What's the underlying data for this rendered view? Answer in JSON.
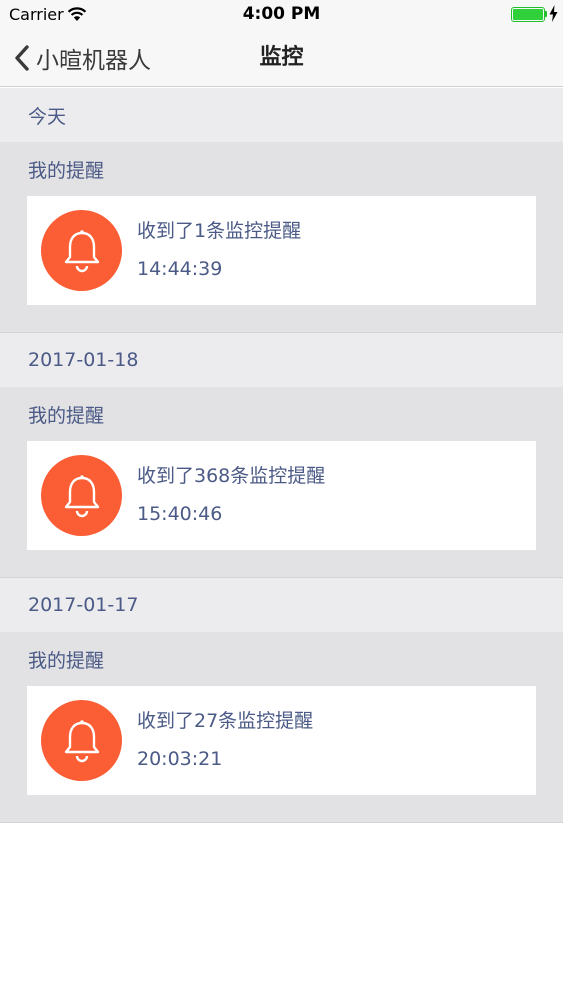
{
  "status_bar": {
    "carrier": "Carrier",
    "time": "4:00 PM",
    "battery_level": 1.0,
    "battery_color": "#2fd03a"
  },
  "nav": {
    "back_label": "小暄机器人",
    "title": "监控"
  },
  "colors": {
    "accent": "#fb5d35",
    "text": "#4b5a86"
  },
  "sections": [
    {
      "date": "今天",
      "group_title": "我的提醒",
      "card": {
        "icon": "bell-icon",
        "message": "收到了1条监控提醒",
        "time": "14:44:39"
      }
    },
    {
      "date": "2017-01-18",
      "group_title": "我的提醒",
      "card": {
        "icon": "bell-icon",
        "message": "收到了368条监控提醒",
        "time": "15:40:46"
      }
    },
    {
      "date": "2017-01-17",
      "group_title": "我的提醒",
      "card": {
        "icon": "bell-icon",
        "message": "收到了27条监控提醒",
        "time": "20:03:21"
      }
    }
  ]
}
